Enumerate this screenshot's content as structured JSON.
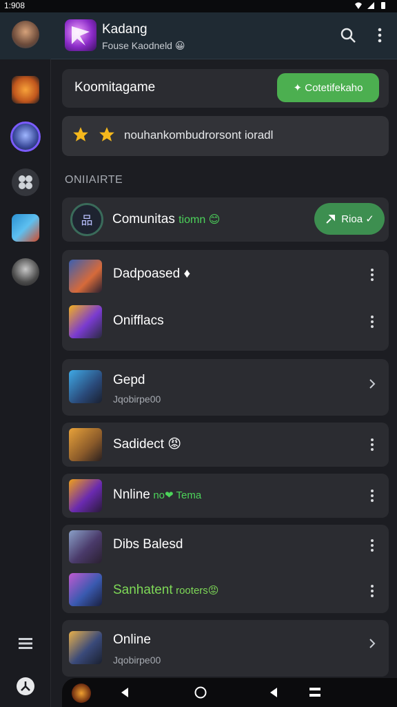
{
  "status_bar": {
    "time": "1:908"
  },
  "header": {
    "title": "Kadang",
    "subtitle": "Fouse Kaodneld 😀",
    "search_icon": "search-icon",
    "more_icon": "more-vertical-icon"
  },
  "banner": {
    "title": "Koomitagame",
    "button_label": "✦ Cotetifekaho"
  },
  "stars_row": {
    "text": "nouhankombudrorsont ioradl"
  },
  "section": {
    "label": "ONIIAIRTE"
  },
  "community": {
    "name": "Comunitas",
    "highlight": "tiomn 😊",
    "button_label": "Rioa ✓"
  },
  "games": [
    {
      "name": "Dadpoased ♦",
      "sub": ""
    },
    {
      "name": "Onifflacs",
      "sub": ""
    },
    {
      "name": "Gepd",
      "sub": "Jqobirpe00"
    },
    {
      "name": "Sadidect 😡",
      "sub": ""
    },
    {
      "name": "Nnline",
      "sub": "",
      "tag": "no❤ Tema"
    },
    {
      "name": "Dibs Balesd",
      "sub": ""
    },
    {
      "name": "Sanhatent",
      "sub": "",
      "tag": "rooters😡"
    },
    {
      "name": "Online",
      "sub": "Jqobirpe00"
    }
  ],
  "rail": {
    "bottom_icons": [
      "menu-icon",
      "profile-icon"
    ]
  },
  "colors": {
    "accent_green": "#4caf50",
    "header_bg": "#1f2a33",
    "card_bg": "#2b2c31"
  }
}
